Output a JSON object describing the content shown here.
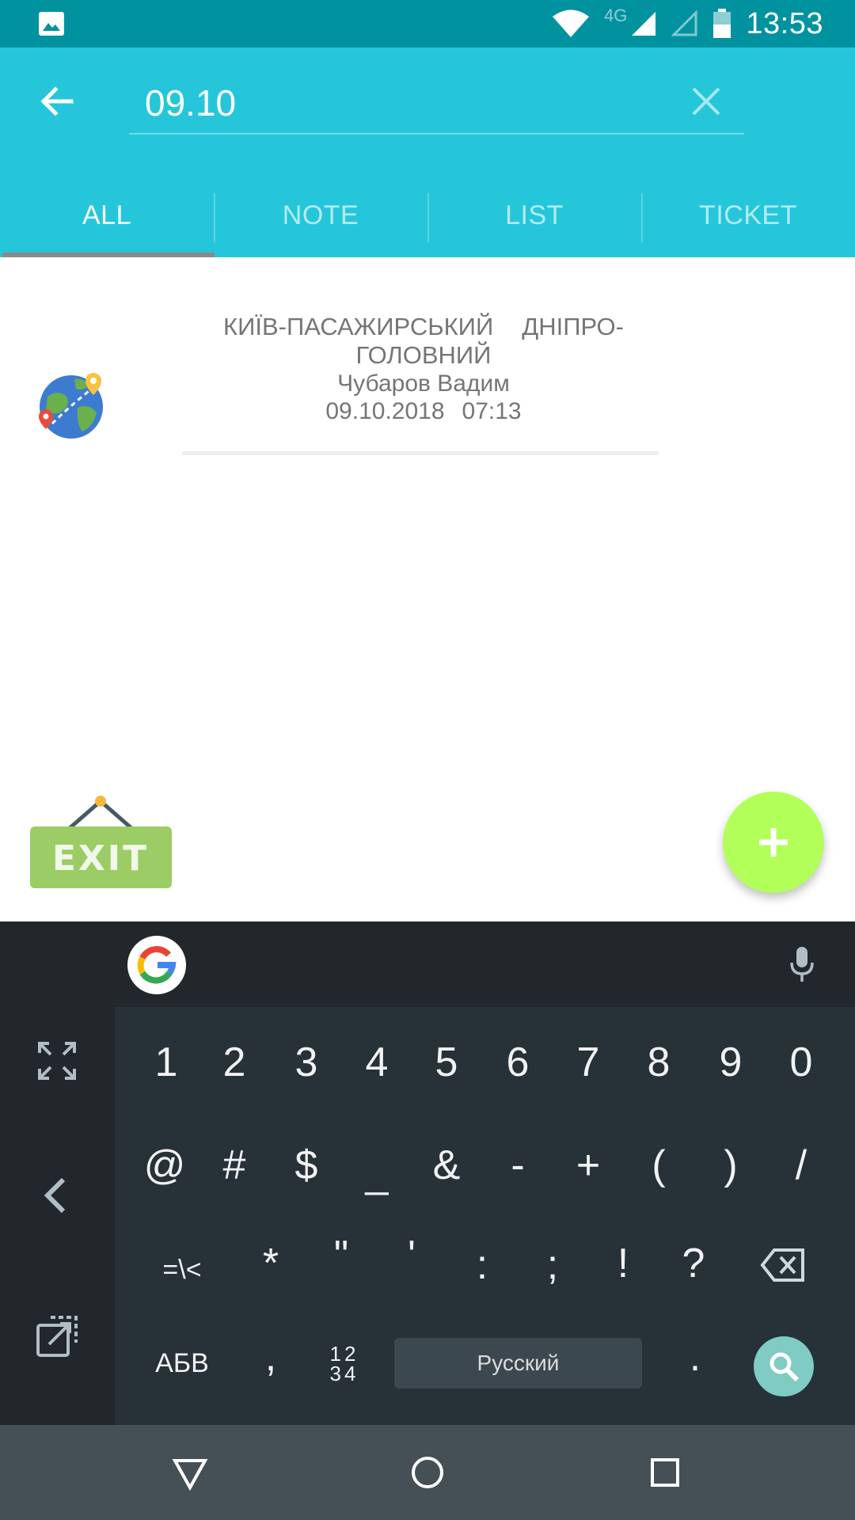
{
  "status_bar": {
    "network_label": "4G",
    "time": "13:53"
  },
  "search": {
    "query": "09.10"
  },
  "tabs": [
    {
      "label": "ALL",
      "active": true
    },
    {
      "label": "NOTE",
      "active": false
    },
    {
      "label": "LIST",
      "active": false
    },
    {
      "label": "TICKET",
      "active": false
    }
  ],
  "results": [
    {
      "from": "КИЇВ-ПАСАЖИРСЬКИЙ",
      "to": "ДНІПРО-ГОЛОВНИЙ",
      "passenger": "Чубаров Вадим",
      "date": "09.10.2018",
      "time": "07:13",
      "icon": "globe-route-icon"
    }
  ],
  "exit_sign": {
    "label": "EXIT"
  },
  "fab": {
    "icon": "plus-icon"
  },
  "keyboard": {
    "row1": [
      "1",
      "2",
      "3",
      "4",
      "5",
      "6",
      "7",
      "8",
      "9",
      "0"
    ],
    "row2": [
      "@",
      "#",
      "$",
      "_",
      "&",
      "-",
      "+",
      "(",
      ")",
      "/"
    ],
    "row3": [
      "=\\<",
      "*",
      "\"",
      "'",
      ":",
      ";",
      "!",
      "?"
    ],
    "row4": {
      "alpha_switch": "АБВ",
      "comma": ",",
      "num_switch_top": "12",
      "num_switch_bottom": "34",
      "language": "Русский",
      "period": "."
    }
  },
  "colors": {
    "status_bar": "#00939f",
    "app_bar": "#26c6da",
    "fab": "#b2ff59",
    "keyboard_bg": "#263238",
    "search_key": "#80cbc4"
  }
}
